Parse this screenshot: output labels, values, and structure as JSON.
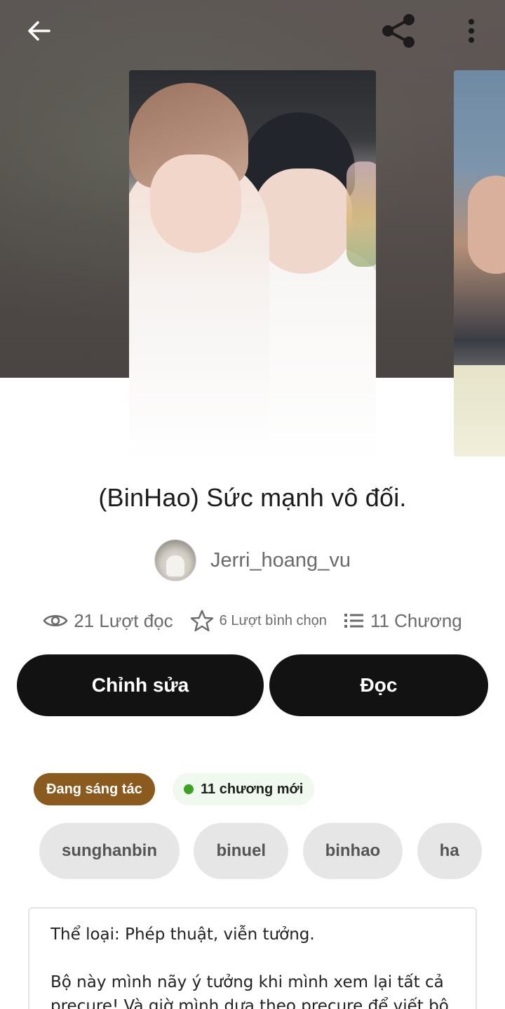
{
  "header": {
    "back_icon": "arrow-left-icon",
    "share_icon": "share-icon",
    "more_icon": "more-vertical-icon"
  },
  "story": {
    "title": "(BinHao) Sức mạnh vô đối.",
    "author": "Jerri_hoang_vu"
  },
  "stats": {
    "reads": "21 Lượt đọc",
    "votes": "6 Lượt bình chọn",
    "chapters": "11 Chương"
  },
  "actions": {
    "edit_label": "Chỉnh sửa",
    "read_label": "Đọc"
  },
  "badges": {
    "status": "Đang sáng tác",
    "status_color": "#8a5a1e",
    "new_chapters": "11 chương mới",
    "new_dot_color": "#3da126"
  },
  "tags": [
    "sunghanbin",
    "binuel",
    "binhao",
    "ha"
  ],
  "description": {
    "line1": "Thể loại: Phép thuật, viễn tưởng.",
    "line2": "Bộ này mình nãy ý tưởng khi mình xem lại tất cả",
    "line3": "precure! Và giờ mình dựa theo precure để viết bộ"
  }
}
